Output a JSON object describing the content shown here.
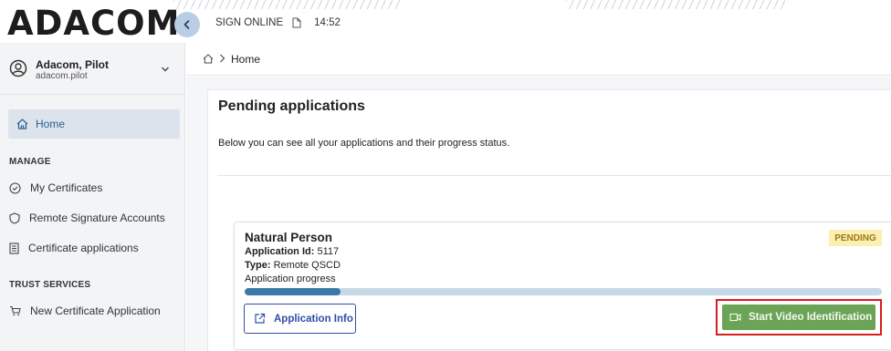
{
  "app": {
    "logo_text": "ADACOM",
    "sign_online_label": "SIGN ONLINE",
    "clock": "14:52"
  },
  "user": {
    "name": "Adacom, Pilot",
    "login": "adacom.pilot"
  },
  "sidebar": {
    "home_label": "Home",
    "manage_title": "MANAGE",
    "manage_items": [
      {
        "label": "My Certificates",
        "icon": "check-circle-icon"
      },
      {
        "label": "Remote Signature Accounts",
        "icon": "shield-icon"
      },
      {
        "label": "Certificate applications",
        "icon": "document-list-icon"
      }
    ],
    "trust_title": "TRUST SERVICES",
    "trust_items": [
      {
        "label": "New Certificate Application",
        "icon": "cart-icon"
      }
    ]
  },
  "breadcrumb": {
    "current": "Home"
  },
  "page": {
    "title": "Pending applications",
    "description": "Below you can see all your applications and their progress status."
  },
  "application": {
    "title": "Natural Person",
    "status": "PENDING",
    "id_label": "Application Id:",
    "id_value": "5117",
    "type_label": "Type:",
    "type_value": "Remote QSCD",
    "progress_label": "Application progress",
    "progress_fraction": 0.15,
    "info_button": "Application Info",
    "video_button": "Start Video Identification"
  },
  "colors": {
    "accent_blue": "#2f4fa3",
    "progress_fill": "#3a79a8",
    "progress_track": "#c7d9e6",
    "video_green": "#6ca457",
    "highlight_red": "#d81e1e",
    "badge_bg": "#fdeeb4"
  }
}
